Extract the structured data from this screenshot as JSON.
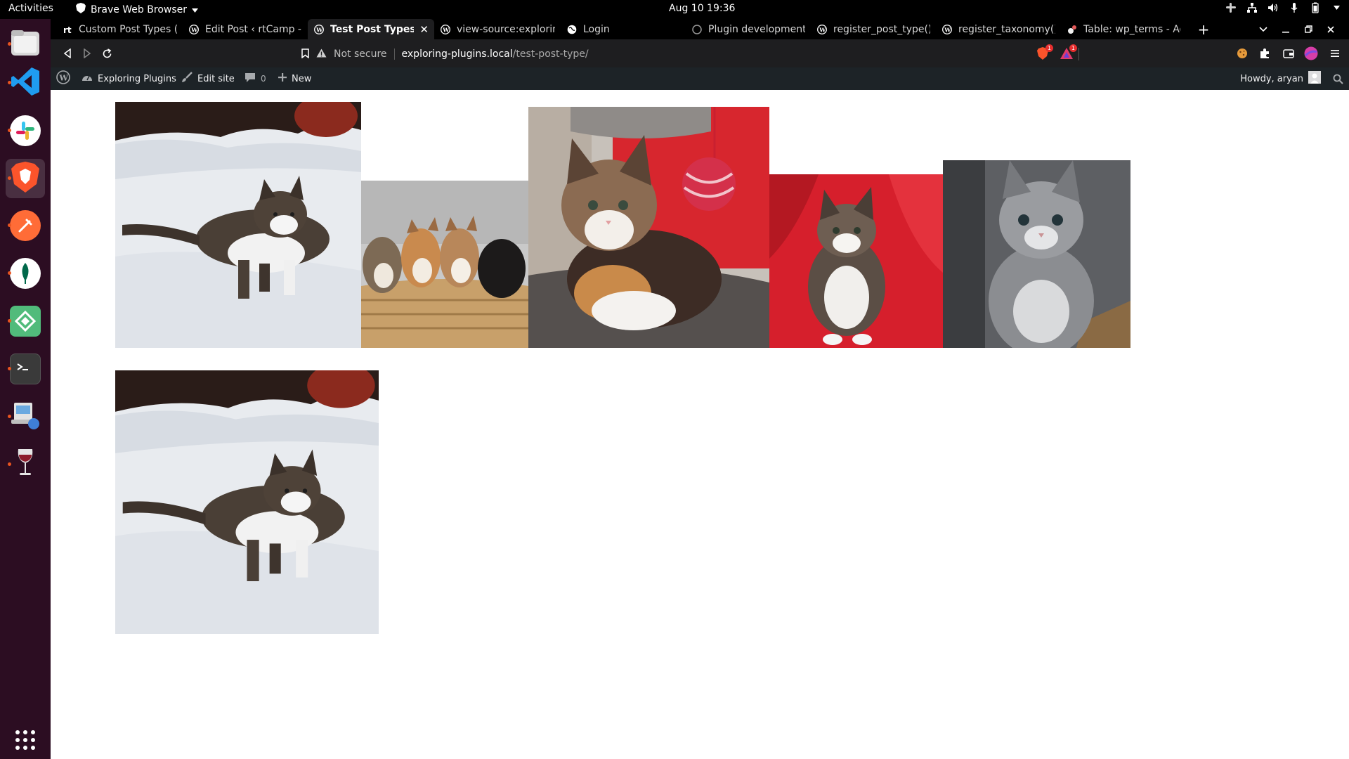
{
  "system": {
    "activities_label": "Activities",
    "app_menu_label": "Brave Web Browser",
    "clock": "Aug 10  19:36"
  },
  "dock": {
    "items": [
      {
        "name": "files-app",
        "active": false
      },
      {
        "name": "vscode-app",
        "active": false
      },
      {
        "name": "slack-app",
        "active": false
      },
      {
        "name": "brave-app",
        "active": true
      },
      {
        "name": "postman-app",
        "active": false
      },
      {
        "name": "mongodb-compass-app",
        "active": false
      },
      {
        "name": "local-app",
        "active": false
      },
      {
        "name": "terminal-app",
        "active": false
      },
      {
        "name": "remote-desktop-app",
        "active": false
      },
      {
        "name": "wine-app",
        "active": false
      }
    ],
    "show_apps_icon": "grid-icon"
  },
  "browser": {
    "tabs": [
      {
        "title": "Custom Post Types (C",
        "icon": "rtcamp-icon",
        "active": false
      },
      {
        "title": "Edit Post ‹ rtCamp - N",
        "icon": "wordpress-icon",
        "active": false
      },
      {
        "title": "Test Post Types –",
        "icon": "wordpress-icon",
        "active": true
      },
      {
        "title": "view-source:explorin",
        "icon": "wordpress-icon",
        "active": false
      },
      {
        "title": "Login",
        "icon": "globe-icon",
        "active": false
      },
      {
        "title": "Plugin development",
        "icon": "github-icon",
        "active": false
      },
      {
        "title": "register_post_type()",
        "icon": "wordpress-icon",
        "active": false
      },
      {
        "title": "register_taxonomy()",
        "icon": "wordpress-icon",
        "active": false
      },
      {
        "title": "Table: wp_terms - Ad",
        "icon": "adminer-icon",
        "active": false
      }
    ],
    "new_tab_label": "+",
    "url": {
      "security_label": "Not secure",
      "host": "exploring-plugins.local",
      "path": "/test-post-type/"
    },
    "shields_count": "1",
    "rewards_count": "1"
  },
  "wp_admin_bar": {
    "site_name": "Exploring Plugins",
    "edit_site_label": "Edit site",
    "comments_count": "0",
    "new_label": "New",
    "greeting": "Howdy, aryan"
  },
  "gallery": {
    "images": [
      {
        "subject": "tabby kitten walking in snow",
        "row": 1
      },
      {
        "subject": "four kittens in a basket",
        "row": 1
      },
      {
        "subject": "calico fluffy kitten with red yarn ball",
        "row": 1
      },
      {
        "subject": "tabby kitten on red chair",
        "row": 1
      },
      {
        "subject": "grey tabby kitten sitting",
        "row": 1
      },
      {
        "subject": "tabby kitten walking in snow",
        "row": 2
      }
    ]
  },
  "colors": {
    "dock_bg": "#2c0d22",
    "wp_bar_bg": "#1d2327",
    "toolbar_bg": "#1e1e20",
    "accent_orange": "#e95420"
  }
}
